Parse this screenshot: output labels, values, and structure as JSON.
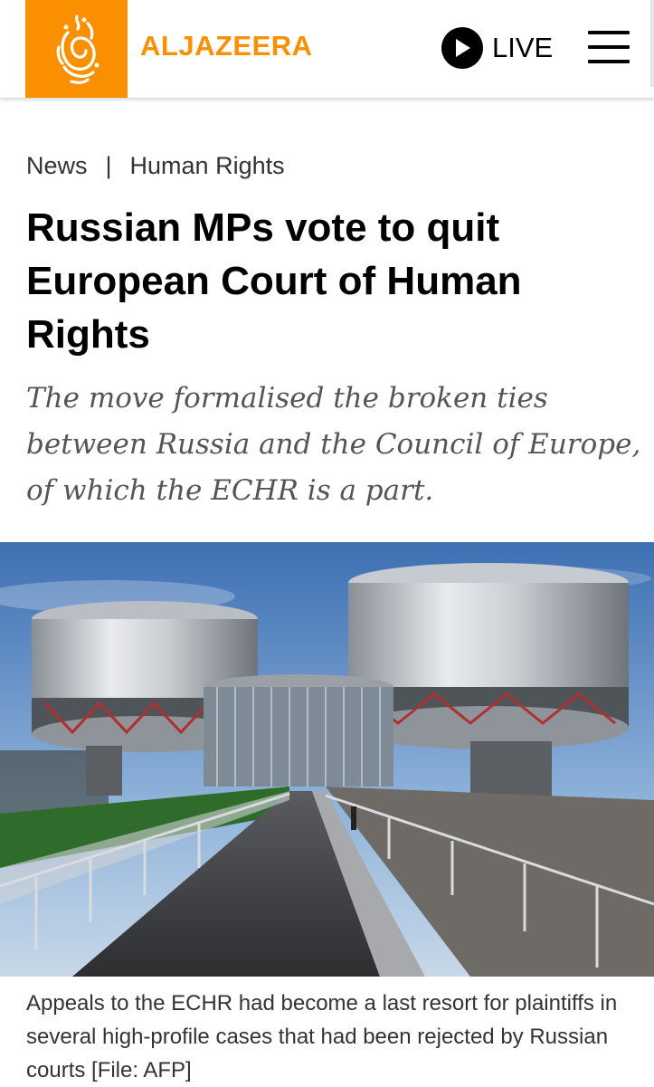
{
  "header": {
    "brand": "ALJAZEERA",
    "live_label": "LIVE",
    "logo_icon": "aljazeera-calligraphy-logo",
    "live_icon": "play-icon",
    "menu_icon": "hamburger-menu-icon",
    "brand_color": "#fa9000"
  },
  "breadcrumb": {
    "items": [
      "News",
      "Human Rights"
    ],
    "separator": "|"
  },
  "article": {
    "title": "Russian MPs vote to quit European Court of Human Rights",
    "subtitle": "The move formalised the broken ties between Russia and the Council of Europe, of which the ECHR is a part.",
    "image_caption": "Appeals to the ECHR had become a last resort for plaintiffs in several high-profile cases that had been rejected by Russian courts [File: AFP]"
  }
}
